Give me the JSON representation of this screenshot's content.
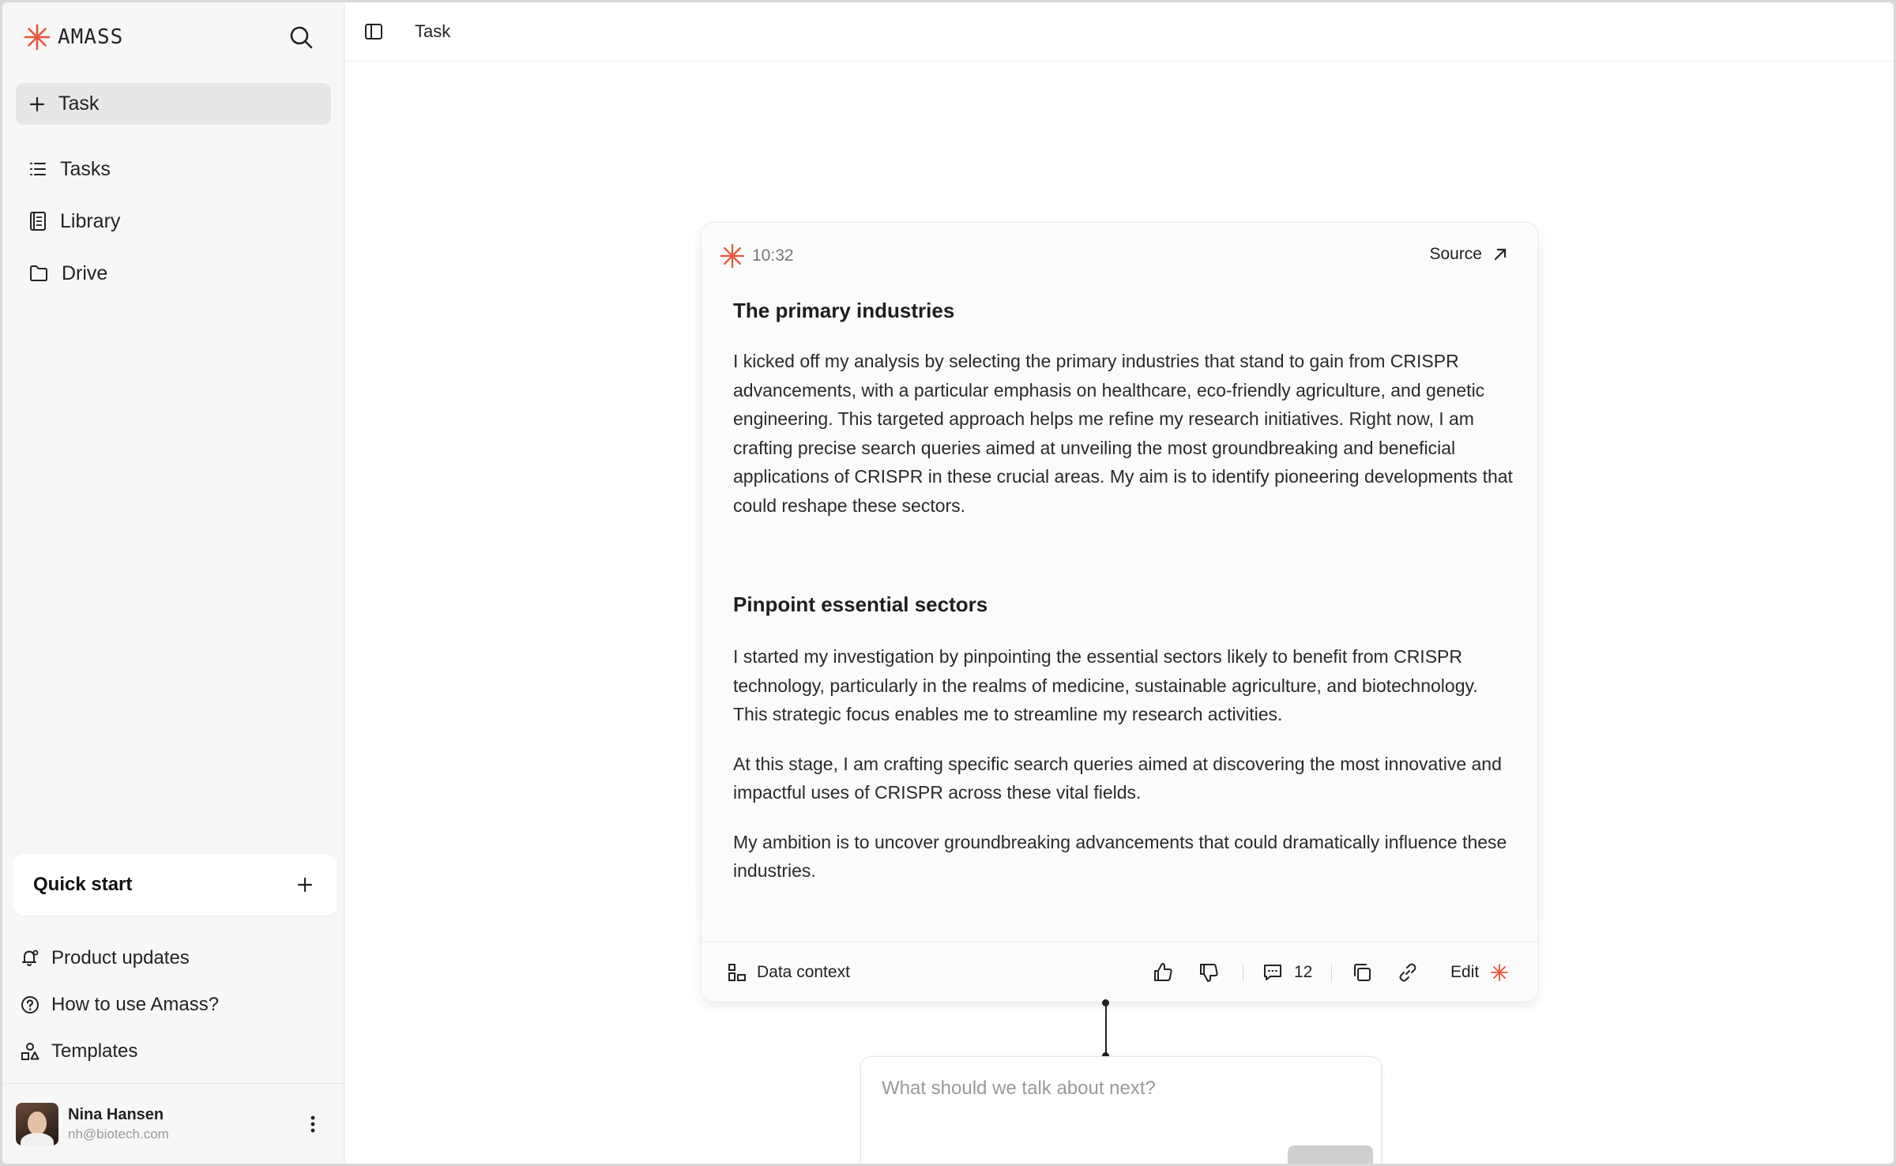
{
  "app": {
    "name": "AMASS",
    "accent": "#e8553a"
  },
  "sidebar": {
    "new_task_label": "Task",
    "items": [
      {
        "label": "Tasks",
        "icon": "list-icon"
      },
      {
        "label": "Library",
        "icon": "book-icon"
      },
      {
        "label": "Drive",
        "icon": "folder-icon"
      }
    ],
    "quick_start_label": "Quick start",
    "footer_items": [
      {
        "label": "Product updates",
        "icon": "bell-icon"
      },
      {
        "label": "How to use Amass?",
        "icon": "help-circle-icon"
      },
      {
        "label": "Templates",
        "icon": "shapes-icon"
      }
    ],
    "user": {
      "name": "Nina Hansen",
      "email": "nh@biotech.com"
    }
  },
  "header": {
    "breadcrumb": "Task"
  },
  "card": {
    "time": "10:32",
    "source_label": "Source",
    "sections": [
      {
        "title": "The primary industries",
        "paragraphs": [
          "I kicked off my analysis by selecting the primary industries that stand to gain from CRISPR advancements, with a particular emphasis on healthcare, eco-friendly agriculture, and genetic engineering. This targeted approach helps me refine my research initiatives. Right now, I am crafting precise search queries aimed at unveiling the most groundbreaking and beneficial applications of CRISPR in these crucial areas. My aim is to identify pioneering developments that could reshape these sectors."
        ]
      },
      {
        "title": "Pinpoint essential sectors",
        "paragraphs": [
          "I started my investigation by pinpointing the essential sectors likely to benefit from CRISPR technology, particularly in the realms of medicine, sustainable agriculture, and biotechnology. This strategic focus enables me to streamline my research activities.",
          "At this stage, I am crafting specific search queries aimed at discovering the most innovative and impactful uses of CRISPR across these vital fields.",
          "My ambition is to uncover groundbreaking advancements that could dramatically influence these industries."
        ]
      }
    ],
    "footer": {
      "data_context_label": "Data context",
      "comment_count": "12",
      "edit_label": "Edit"
    }
  },
  "composer": {
    "placeholder": "What should we talk about next?"
  }
}
